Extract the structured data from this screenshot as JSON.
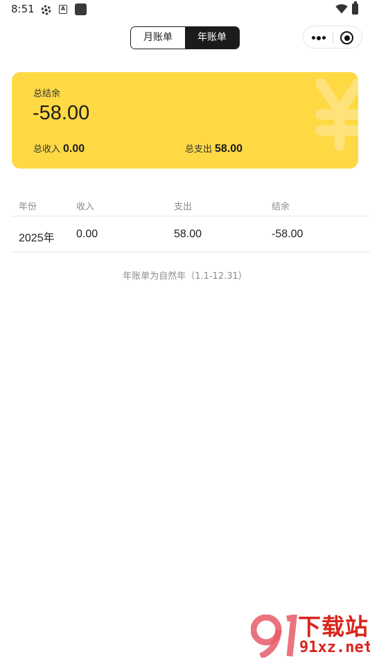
{
  "status_bar": {
    "time": "8:51",
    "icons": [
      "settings-icon",
      "font-a-icon",
      "app-square-icon",
      "wifi-icon",
      "battery-charging-icon"
    ]
  },
  "header": {
    "tabs": [
      {
        "label": "月账单",
        "active": false
      },
      {
        "label": "年账单",
        "active": true
      }
    ],
    "capsule": {
      "icons": [
        "more-dots-icon",
        "target-close-icon"
      ]
    }
  },
  "summary": {
    "balance_label": "总结余",
    "balance_value": "-58.00",
    "income_label": "总收入",
    "income_value": "0.00",
    "expense_label": "总支出",
    "expense_value": "58.00",
    "decor_icon": "yen-icon",
    "accent_color": "#ffd944"
  },
  "table": {
    "columns": [
      "年份",
      "收入",
      "支出",
      "结余"
    ],
    "rows": [
      [
        "2025年",
        "0.00",
        "58.00",
        "-58.00"
      ]
    ]
  },
  "note": "年账单为自然年（1.1-12.31）",
  "watermark": {
    "title": "下载站",
    "domain": "91xz.net",
    "color": "#d8251c"
  }
}
